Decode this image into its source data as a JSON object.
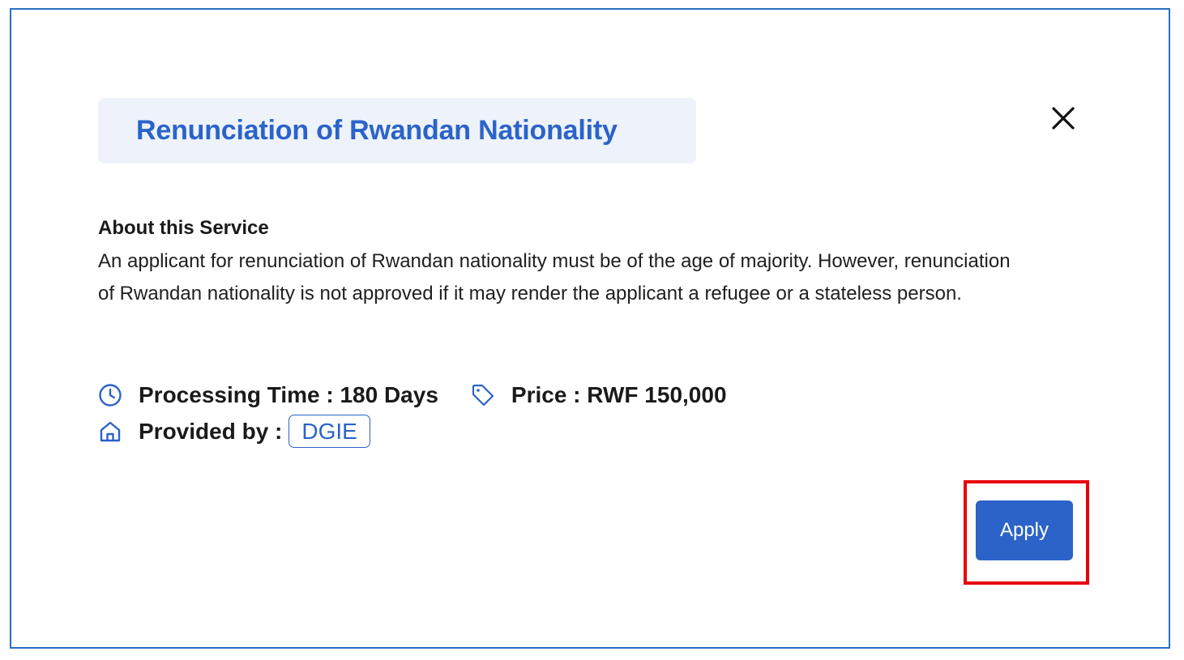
{
  "modal": {
    "title": "Renunciation of Rwandan Nationality",
    "close_icon": "close-icon"
  },
  "about": {
    "heading": "About this Service",
    "description": "An applicant for renunciation of Rwandan nationality must be of the age of majority. However, renunciation of Rwandan nationality is not approved if it may render the applicant a refugee or a stateless person."
  },
  "details": {
    "processing_time": "Processing Time : 180 Days",
    "price": "Price : RWF 150,000",
    "provided_by_label": "Provided by :",
    "provider": "DGIE"
  },
  "actions": {
    "apply_label": "Apply"
  },
  "icons": {
    "processing": "clock-icon",
    "price": "tag-icon",
    "provider": "home-icon"
  },
  "colors": {
    "accent": "#2b63c8",
    "title_bg": "#edf2fb",
    "modal_border": "#2a6fc1",
    "highlight": "#e8000b"
  }
}
